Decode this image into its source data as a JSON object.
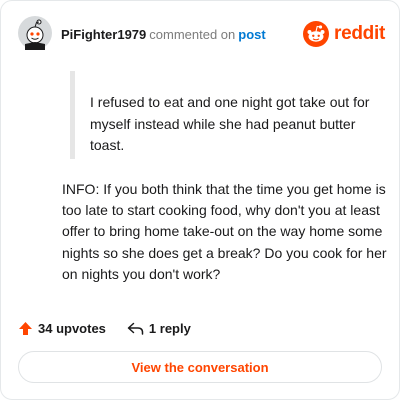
{
  "header": {
    "username": "PiFighter1979",
    "action_text": "commented on",
    "post_link": "post",
    "logo_text": "reddit"
  },
  "quote": {
    "text": "I refused to eat and one night got take out for myself instead while she had peanut butter toast."
  },
  "comment": {
    "text": "INFO: If you both think that the time you get home is too late to start cooking food, why don't you at least offer to bring home take-out on the way home some nights so she does get a break? Do you cook for her on nights you don't work?"
  },
  "actions": {
    "upvotes": "34 upvotes",
    "replies": "1 reply"
  },
  "view_button": "View the conversation",
  "colors": {
    "brand": "#ff4500",
    "link": "#0079d3",
    "quote_border": "#e6e6e6"
  },
  "icons": {
    "avatar": "snoo-avatar",
    "logo": "reddit-alien-logo",
    "upvote": "upvote-arrow",
    "reply": "reply-arrow"
  }
}
